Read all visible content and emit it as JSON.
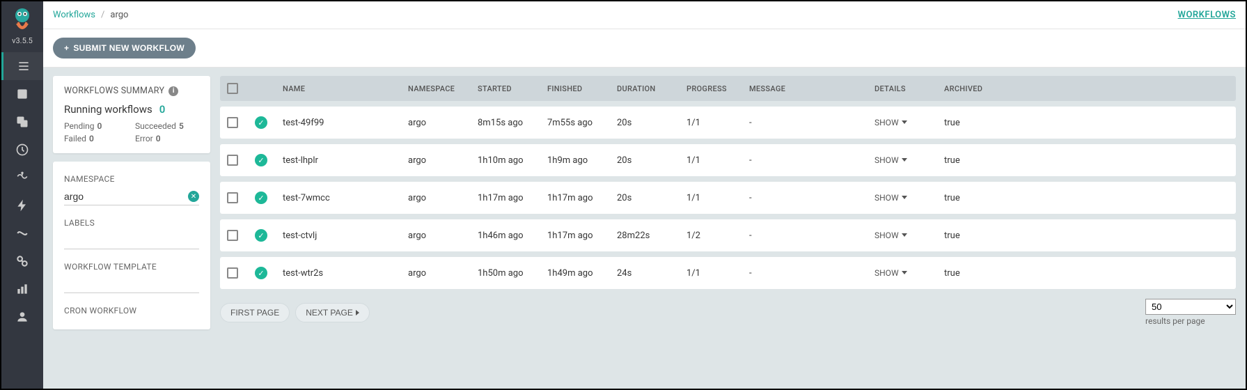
{
  "version": "v3.5.5",
  "breadcrumb": {
    "root": "Workflows",
    "current": "argo"
  },
  "toplink": "WORKFLOWS",
  "submit_label": "SUBMIT NEW WORKFLOW",
  "summary": {
    "title": "WORKFLOWS SUMMARY",
    "running_label": "Running workflows",
    "running_count": "0",
    "pending_label": "Pending",
    "pending_val": "0",
    "succeeded_label": "Succeeded",
    "succeeded_val": "5",
    "failed_label": "Failed",
    "failed_val": "0",
    "error_label": "Error",
    "error_val": "0"
  },
  "filters": {
    "namespace_label": "NAMESPACE",
    "namespace_value": "argo",
    "labels_label": "LABELS",
    "labels_value": "",
    "wft_label": "WORKFLOW TEMPLATE",
    "wft_value": "",
    "cron_label": "CRON WORKFLOW"
  },
  "columns": {
    "name": "NAME",
    "namespace": "NAMESPACE",
    "started": "STARTED",
    "finished": "FINISHED",
    "duration": "DURATION",
    "progress": "PROGRESS",
    "message": "MESSAGE",
    "details": "DETAILS",
    "archived": "ARCHIVED"
  },
  "rows": [
    {
      "name": "test-49f99",
      "namespace": "argo",
      "started": "8m15s ago",
      "finished": "7m55s ago",
      "duration": "20s",
      "progress": "1/1",
      "message": "-",
      "details": "SHOW",
      "archived": "true"
    },
    {
      "name": "test-lhplr",
      "namespace": "argo",
      "started": "1h10m ago",
      "finished": "1h9m ago",
      "duration": "20s",
      "progress": "1/1",
      "message": "-",
      "details": "SHOW",
      "archived": "true"
    },
    {
      "name": "test-7wmcc",
      "namespace": "argo",
      "started": "1h17m ago",
      "finished": "1h17m ago",
      "duration": "20s",
      "progress": "1/1",
      "message": "-",
      "details": "SHOW",
      "archived": "true"
    },
    {
      "name": "test-ctvlj",
      "namespace": "argo",
      "started": "1h46m ago",
      "finished": "1h17m ago",
      "duration": "28m22s",
      "progress": "1/2",
      "message": "-",
      "details": "SHOW",
      "archived": "true"
    },
    {
      "name": "test-wtr2s",
      "namespace": "argo",
      "started": "1h50m ago",
      "finished": "1h49m ago",
      "duration": "24s",
      "progress": "1/1",
      "message": "-",
      "details": "SHOW",
      "archived": "true"
    }
  ],
  "pagination": {
    "first": "FIRST PAGE",
    "next": "NEXT PAGE",
    "page_size": "50",
    "results_label": "results per page"
  }
}
